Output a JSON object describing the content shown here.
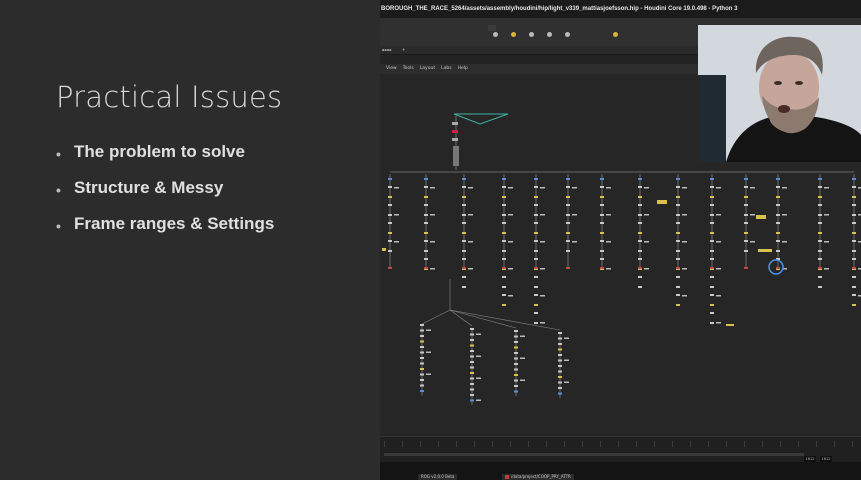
{
  "slide": {
    "title": "Practical Issues",
    "bullets": [
      "The problem to solve",
      "Structure & Messy",
      "Frame ranges & Settings"
    ]
  },
  "app": {
    "window_title": "BOROUGH_THE_RACE_5264/assets/assembly/houdini/hip/light_v339_mattiasjoefsson.hip - Houdini Core 19.0.498 - Python 3",
    "menu": [
      "View",
      "Tools",
      "Layout",
      "Labs",
      "Help"
    ],
    "timeline": {
      "end_frame_a": "1812",
      "end_frame_b": "1812"
    },
    "status_tabs": [
      "ROG v2.0.0 Beta",
      "/data/project/COOP_PRY_ATTR"
    ]
  },
  "colors": {
    "slide_bg": "#2c2c2c",
    "network_bg": "#262626",
    "node_yellow": "#d9c14a",
    "node_blue": "#5a8fd6",
    "wire_teal": "#3fb3a4",
    "selection_ring": "#4a90e2"
  },
  "icons": [
    "sun-light-icon",
    "spot-light-icon",
    "area-light-icon",
    "environment-light-icon",
    "camera-icon",
    "bulb-icon"
  ]
}
